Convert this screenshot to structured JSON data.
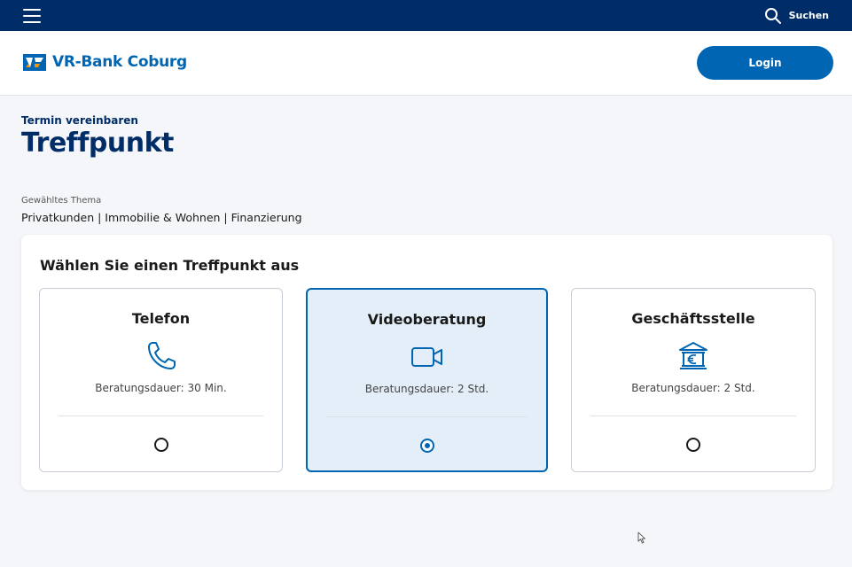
{
  "topbar": {
    "search_label": "Suchen"
  },
  "header": {
    "brand": "VR-Bank Coburg",
    "login_label": "Login"
  },
  "page": {
    "eyebrow": "Termin vereinbaren",
    "title": "Treffpunkt",
    "topic_label": "Gewähltes Thema",
    "topic_value": "Privatkunden | Immobilie & Wohnen | Finanzierung"
  },
  "panel": {
    "title": "Wählen Sie einen Treffpunkt aus",
    "options": [
      {
        "title": "Telefon",
        "duration": "Beratungsdauer: 30 Min.",
        "icon": "phone-icon",
        "selected": false
      },
      {
        "title": "Videoberatung",
        "duration": "Beratungsdauer: 2 Std.",
        "icon": "video-camera-icon",
        "selected": true
      },
      {
        "title": "Geschäftsstelle",
        "duration": "Beratungsdauer: 2 Std.",
        "icon": "bank-euro-icon",
        "selected": false
      }
    ]
  },
  "colors": {
    "navy": "#002d67",
    "primary": "#0066b3",
    "selected_bg": "#e3eef8",
    "logo_orange": "#f39200"
  }
}
